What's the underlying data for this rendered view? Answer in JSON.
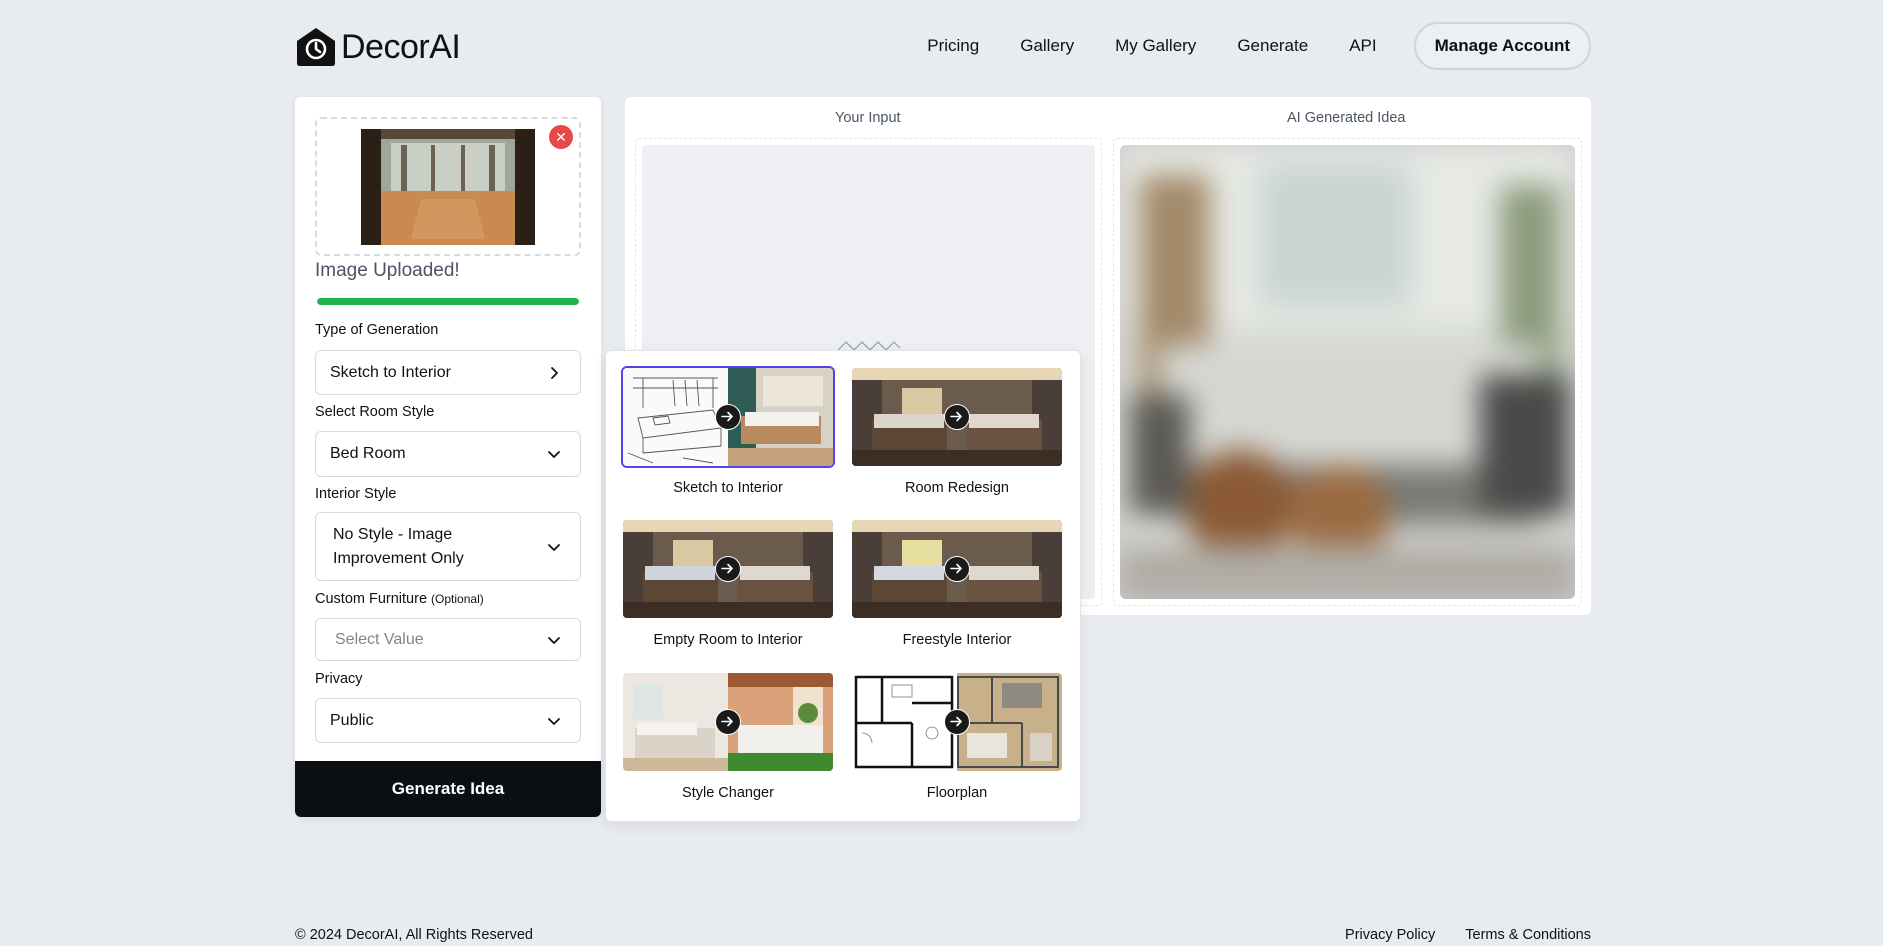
{
  "brand": {
    "name": "DecorAI"
  },
  "nav": {
    "items": [
      "Pricing",
      "Gallery",
      "My Gallery",
      "Generate",
      "API"
    ],
    "manage_account": "Manage Account"
  },
  "form": {
    "upload_status": "Image Uploaded!",
    "upload_progress_percent": 100,
    "type_label": "Type of Generation",
    "type_value": "Sketch to Interior",
    "room_label": "Select Room Style",
    "room_value": "Bed Room",
    "interior_label": "Interior Style",
    "interior_value_line1": "No Style - Image",
    "interior_value_line2": "Improvement Only",
    "furniture_label": "Custom Furniture",
    "furniture_optional": "(Optional)",
    "furniture_placeholder": "Select Value",
    "privacy_label": "Privacy",
    "privacy_value": "Public",
    "generate_button": "Generate Idea"
  },
  "preview": {
    "input_title": "Your Input",
    "generated_title": "AI Generated Idea"
  },
  "generation_types": [
    {
      "label": "Sketch to Interior",
      "selected": true
    },
    {
      "label": "Room Redesign",
      "selected": false
    },
    {
      "label": "Empty Room to Interior",
      "selected": false
    },
    {
      "label": "Freestyle Interior",
      "selected": false
    },
    {
      "label": "Style Changer",
      "selected": false
    },
    {
      "label": "Floorplan",
      "selected": false
    }
  ],
  "footer": {
    "copyright": "© 2024 DecorAI, All Rights Reserved",
    "privacy": "Privacy Policy",
    "terms": "Terms & Conditions"
  },
  "colors": {
    "accent_dark": "#0b0f14",
    "progress": "#22b14c",
    "remove": "#e74848",
    "selected_border": "#4f46e5"
  }
}
